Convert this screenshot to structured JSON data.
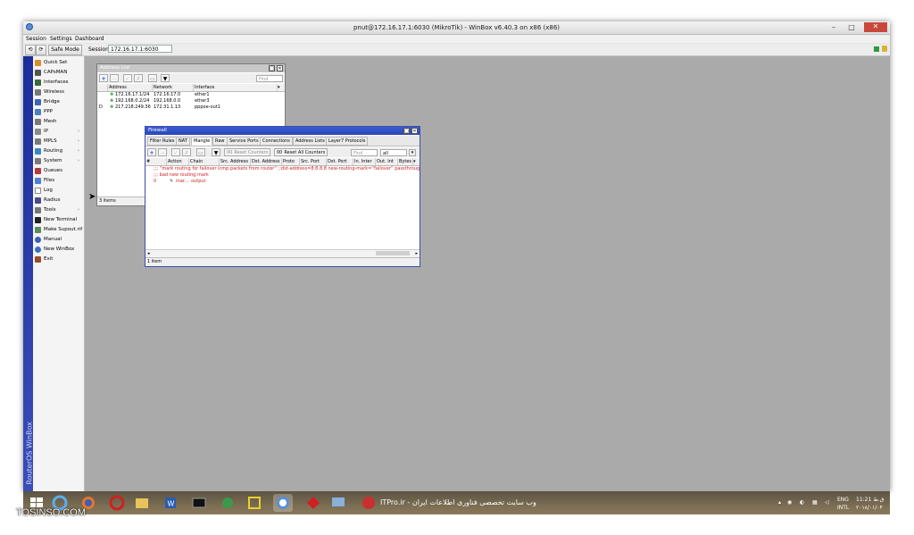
{
  "window": {
    "title": "pnut@172.16.17.1:6030 (MikroTik) - WinBox v6.40.3 on x86 (x86)",
    "minimize": "–",
    "maximize": "□",
    "close": "✕"
  },
  "menu": [
    "Session",
    "Settings",
    "Dashboard"
  ],
  "toolbar": {
    "undo": "⟲",
    "redo": "⟳",
    "safe_mode": "Safe Mode",
    "session_label": "Session:",
    "session_value": "172.16.17.1:6030"
  },
  "brand": "RouterOS WinBox",
  "sidebar": [
    {
      "label": "Quick Set",
      "color": "#d98b2b"
    },
    {
      "label": "CAPsMAN",
      "color": "#555555"
    },
    {
      "label": "Interfaces",
      "color": "#3a6b3a"
    },
    {
      "label": "Wireless",
      "color": "#777777"
    },
    {
      "label": "Bridge",
      "color": "#3f63b5"
    },
    {
      "label": "PPP",
      "color": "#4a7fc0"
    },
    {
      "label": "Mesh",
      "color": "#7a7a7a"
    },
    {
      "label": "IP",
      "color": "#8a8a8a",
      "arrow": true
    },
    {
      "label": "MPLS",
      "color": "#7a7a7a",
      "arrow": true
    },
    {
      "label": "Routing",
      "color": "#3a86c8",
      "arrow": true
    },
    {
      "label": "System",
      "color": "#7a7a7a",
      "arrow": true
    },
    {
      "label": "Queues",
      "color": "#b23a3a"
    },
    {
      "label": "Files",
      "color": "#4f7fd0"
    },
    {
      "label": "Log",
      "color": "#ffffff"
    },
    {
      "label": "Radius",
      "color": "#4a4a8a"
    },
    {
      "label": "Tools",
      "color": "#777777",
      "arrow": true
    },
    {
      "label": "New Terminal",
      "color": "#222222"
    },
    {
      "label": "Make Supout.rif",
      "color": "#5c8a5c"
    },
    {
      "label": "Manual",
      "color": "#3a5fb8"
    },
    {
      "label": "New WinBox",
      "color": "#3a6fc8"
    },
    {
      "label": "Exit",
      "color": "#9b4a2a"
    }
  ],
  "address_list": {
    "title": "Address List",
    "find_placeholder": "Find",
    "columns": [
      "Address",
      "Network",
      "Interface"
    ],
    "rows": [
      {
        "flag": "",
        "address": "172.16.17.1/24",
        "network": "172.16.17.0",
        "interface": "ether1"
      },
      {
        "flag": "",
        "address": "192.168.0.2/24",
        "network": "192.168.0.0",
        "interface": "ether3"
      },
      {
        "flag": "D",
        "address": "217.218.249.36",
        "network": "172.31.1.13",
        "interface": "pppoe-out1"
      }
    ],
    "status": "3 items"
  },
  "firewall": {
    "title": "Firewall",
    "tabs": [
      "Filter Rules",
      "NAT",
      "Mangle",
      "Raw",
      "Service Ports",
      "Connections",
      "Address Lists",
      "Layer7 Protocols"
    ],
    "selected_tab": "Mangle",
    "reset_counters": "Reset Counters",
    "reset_all_counters": "Reset All Counters",
    "find_placeholder": "Find",
    "filter_value": "all",
    "columns": [
      "#",
      "Action",
      "Chain",
      "Src. Address",
      "Dst. Address",
      "Proto",
      "Src. Port",
      "Dst. Port",
      "In. Inter",
      "Out. Int",
      "Bytes"
    ],
    "comment1": ";;; ''mark routing for failover icmp packets from router''  ;;dst-address=8.8.8.8 new-routing-mark=''failover'' passthrough=no pr...",
    "comment2": ";;; bad new routing mark",
    "rule": {
      "num": "0",
      "action": "mar...",
      "chain": "output"
    },
    "status": "1 item"
  },
  "taskbar": {
    "watermark": "TOSINSO.COM",
    "itpro": "ITPro.ir - وب سایت تخصصی فناوری اطلاعات ایران",
    "lang_top": "ENG",
    "lang_bottom": "INTL",
    "time": "11:21 ق.ظ",
    "date": "۲۰۱۸/۰۱/۰۴"
  }
}
